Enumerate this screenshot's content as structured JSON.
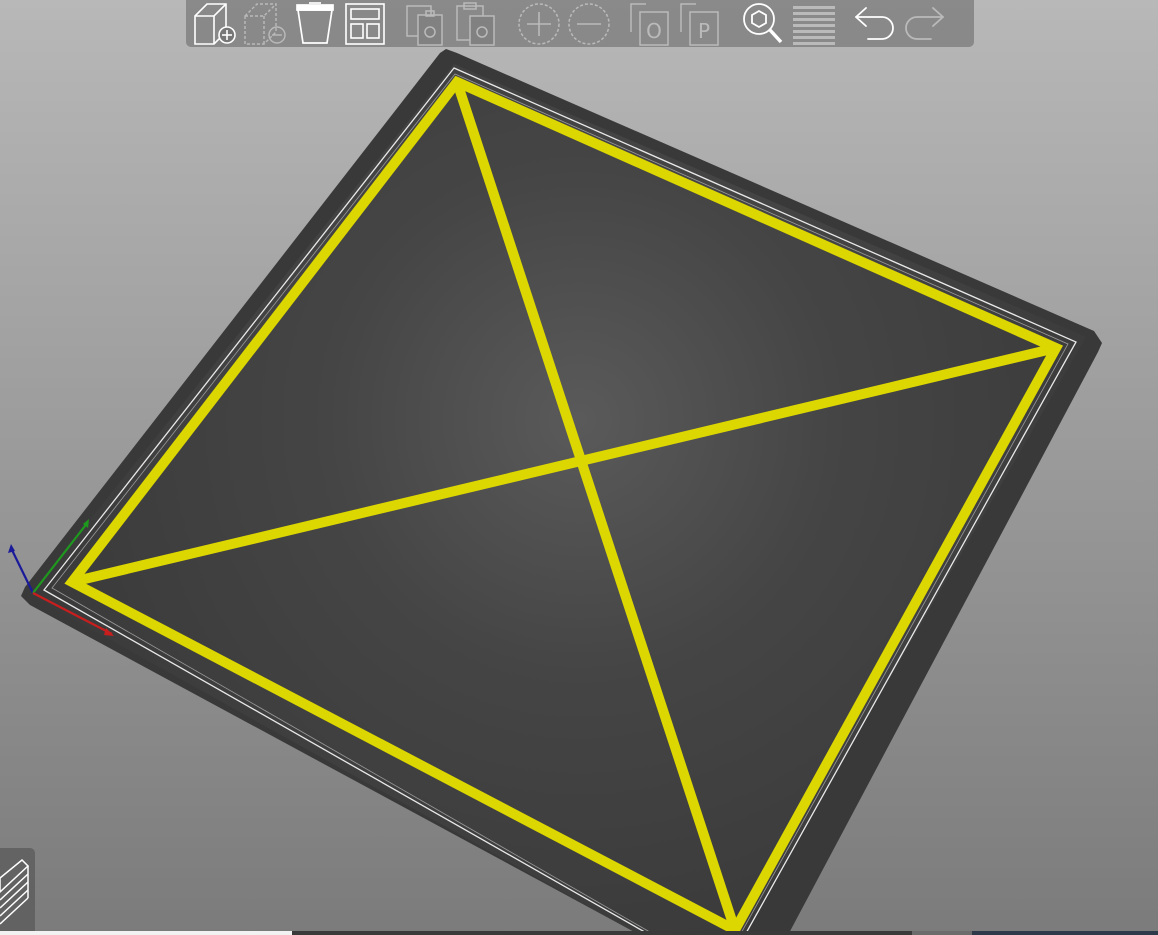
{
  "app": {
    "view": "3D plater"
  },
  "toolbar": {
    "items": [
      {
        "id": "add",
        "icon": "add-object-icon",
        "enabled": true
      },
      {
        "id": "delete",
        "icon": "delete-object-icon",
        "enabled": false
      },
      {
        "id": "delete_all",
        "icon": "delete-all-icon",
        "enabled": true
      },
      {
        "id": "arrange",
        "icon": "arrange-icon",
        "enabled": true
      },
      {
        "id": "copy",
        "icon": "copy-icon",
        "enabled": false
      },
      {
        "id": "paste",
        "icon": "paste-icon",
        "enabled": false
      },
      {
        "id": "add_instance",
        "icon": "add-instance-icon",
        "enabled": false
      },
      {
        "id": "remove_instance",
        "icon": "remove-instance-icon",
        "enabled": false
      },
      {
        "id": "split_objects",
        "icon": "split-objects-icon",
        "enabled": false,
        "glyph": "O"
      },
      {
        "id": "split_parts",
        "icon": "split-parts-icon",
        "enabled": false,
        "glyph": "P"
      },
      {
        "id": "search",
        "icon": "search-icon",
        "enabled": true
      },
      {
        "id": "layers",
        "icon": "layer-editing-icon",
        "enabled": false
      },
      {
        "id": "undo",
        "icon": "undo-icon",
        "enabled": true
      },
      {
        "id": "redo",
        "icon": "redo-icon",
        "enabled": false
      }
    ]
  },
  "bed": {
    "surface_color": "#3d3d3d",
    "outline_color": "#ffffff",
    "highlight_color": "#dcd800",
    "background_top": "#b9b9b9",
    "background_bottom": "#7d7d7d"
  },
  "axes": {
    "x_color": "#c81e1e",
    "y_color": "#1e9a1e",
    "z_color": "#1e1ea0"
  },
  "sidebar_toggle": {
    "icon": "collapse-sidebar-icon"
  }
}
